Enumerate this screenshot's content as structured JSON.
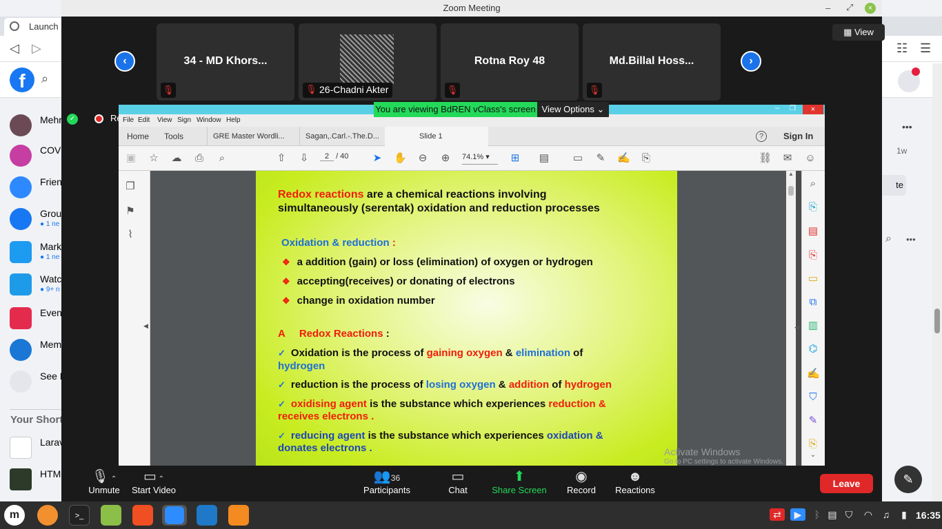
{
  "browser": {
    "tab_title": "Launch M",
    "sidebar": [
      {
        "label": "Mehr",
        "sub": ""
      },
      {
        "label": "COVI",
        "sub": ""
      },
      {
        "label": "Frien",
        "sub": ""
      },
      {
        "label": "Group",
        "sub": "● 1 ne"
      },
      {
        "label": "Marke",
        "sub": "● 1 ne"
      },
      {
        "label": "Watc",
        "sub": "● 9+ n"
      },
      {
        "label": "Even",
        "sub": ""
      },
      {
        "label": "Mem",
        "sub": ""
      },
      {
        "label": "See M",
        "sub": ""
      }
    ],
    "shortcuts_heading": "Your Short",
    "shortcuts": [
      "Larav",
      "HTM"
    ],
    "right_time": "1w",
    "right_button": "te",
    "fb_logo": "f"
  },
  "zoom": {
    "window_title": "Zoom Meeting",
    "view_label": "View",
    "participants": [
      {
        "name": "34 - MD Khors...",
        "label": ""
      },
      {
        "name": "",
        "label": "26-Chadni Akter"
      },
      {
        "name": "Rotna Roy 48",
        "label": ""
      },
      {
        "name": "Md.Billal Hoss...",
        "label": ""
      }
    ],
    "banner": "You are viewing BdREN vClass's screen",
    "view_options": "View Options",
    "recording": "Recording",
    "controls": {
      "unmute": "Unmute",
      "start_video": "Start Video",
      "participants": "Participants",
      "participants_count": "36",
      "chat": "Chat",
      "share_screen": "Share Screen",
      "record": "Record",
      "reactions": "Reactions",
      "leave": "Leave"
    }
  },
  "acrobat": {
    "menu": [
      "File",
      "Edit",
      "View",
      "Sign",
      "Window",
      "Help"
    ],
    "tabs": [
      "Home",
      "Tools",
      "GRE Master Wordli...",
      "Sagan,.Carl.-.The.D...",
      "Slide 1"
    ],
    "sign_in": "Sign In",
    "help": "?",
    "page_current": "2",
    "page_total": "/ 40",
    "zoom_level": "74.1%",
    "watermark_title": "Activate Windows",
    "watermark_sub": "Go to PC settings to activate Windows."
  },
  "slide": {
    "title_red": "Redox reactions",
    "title_rest": " are a chemical reactions involving",
    "title_line2": "simultaneously (serentak)  oxidation and reduction processes",
    "section1": "Oxidation & reduction",
    "section1_colon": " :",
    "bullets": [
      "a addition (gain) or loss (elimination) of oxygen or hydrogen",
      "accepting(receives) or donating of electrons",
      "change in oxidation number"
    ],
    "bullet_glyph": "❖",
    "check_glyph": "✓",
    "sectionA_letter": "A",
    "sectionA_title": "Redox Reactions",
    "sectionA_colon": " :",
    "c1_a": "Oxidation is the process of ",
    "c1_b": "gaining oxygen",
    "c1_c": " & ",
    "c1_d": "elimination",
    "c1_e": " of",
    "c1_f": "hydrogen",
    "c2_a": "reduction is the process of ",
    "c2_b": "losing oxygen",
    "c2_c": " & ",
    "c2_d": "addition",
    "c2_e": " of ",
    "c2_f": "hydrogen",
    "c3_a": "oxidising agent",
    "c3_b": " is the substance which experiences ",
    "c3_c": "reduction  &",
    "c3_d": "receives electrons .",
    "c4_a": "reducing agent",
    "c4_b": "  is the substance which experiences ",
    "c4_c": "oxidation &",
    "c4_d": "donates electrons ."
  },
  "taskbar": {
    "clock": "16:35"
  }
}
